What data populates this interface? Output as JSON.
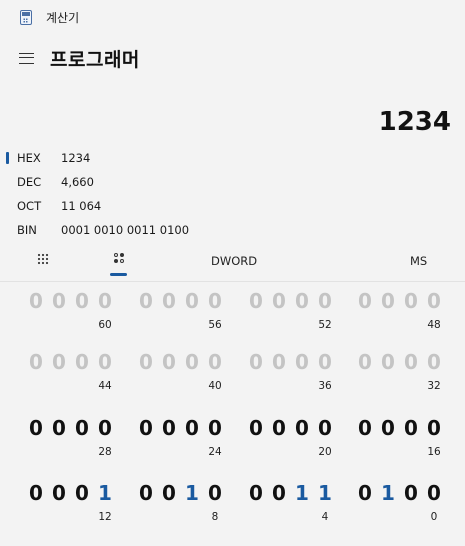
{
  "window": {
    "title": "계산기",
    "icon": "calculator-icon"
  },
  "header": {
    "menu_icon": "hamburger-icon",
    "mode_title": "프로그래머"
  },
  "display": {
    "value": "1234"
  },
  "radix": [
    {
      "name": "HEX",
      "value": "1234",
      "active": true
    },
    {
      "name": "DEC",
      "value": "4,660",
      "active": false
    },
    {
      "name": "OCT",
      "value": "11 064",
      "active": false
    },
    {
      "name": "BIN",
      "value": "0001 0010 0011 0100",
      "active": false
    }
  ],
  "modebar": {
    "keypad_icon": "full-keypad-icon",
    "bittoggle_icon": "bit-toggling-keypad-icon",
    "word_size": "DWORD",
    "memory_store": "MS"
  },
  "bit_rows": [
    {
      "state": "dim",
      "groups": [
        {
          "bits": [
            "0",
            "0",
            "0",
            "0"
          ],
          "label": "60"
        },
        {
          "bits": [
            "0",
            "0",
            "0",
            "0"
          ],
          "label": "56"
        },
        {
          "bits": [
            "0",
            "0",
            "0",
            "0"
          ],
          "label": "52"
        },
        {
          "bits": [
            "0",
            "0",
            "0",
            "0"
          ],
          "label": "48"
        }
      ]
    },
    {
      "state": "dim",
      "groups": [
        {
          "bits": [
            "0",
            "0",
            "0",
            "0"
          ],
          "label": "44"
        },
        {
          "bits": [
            "0",
            "0",
            "0",
            "0"
          ],
          "label": "40"
        },
        {
          "bits": [
            "0",
            "0",
            "0",
            "0"
          ],
          "label": "36"
        },
        {
          "bits": [
            "0",
            "0",
            "0",
            "0"
          ],
          "label": "32"
        }
      ]
    },
    {
      "state": "active",
      "groups": [
        {
          "bits": [
            "0",
            "0",
            "0",
            "0"
          ],
          "label": "28"
        },
        {
          "bits": [
            "0",
            "0",
            "0",
            "0"
          ],
          "label": "24"
        },
        {
          "bits": [
            "0",
            "0",
            "0",
            "0"
          ],
          "label": "20"
        },
        {
          "bits": [
            "0",
            "0",
            "0",
            "0"
          ],
          "label": "16"
        }
      ]
    },
    {
      "state": "active",
      "groups": [
        {
          "bits": [
            "0",
            "0",
            "0",
            "1"
          ],
          "label": "12"
        },
        {
          "bits": [
            "0",
            "0",
            "1",
            "0"
          ],
          "label": "8"
        },
        {
          "bits": [
            "0",
            "0",
            "1",
            "1"
          ],
          "label": "4"
        },
        {
          "bits": [
            "0",
            "1",
            "0",
            "0"
          ],
          "label": "0"
        }
      ]
    }
  ],
  "colors": {
    "accent": "#1a5aa0",
    "dim_bit": "#c4c4c4",
    "background": "#f3f3f3"
  }
}
